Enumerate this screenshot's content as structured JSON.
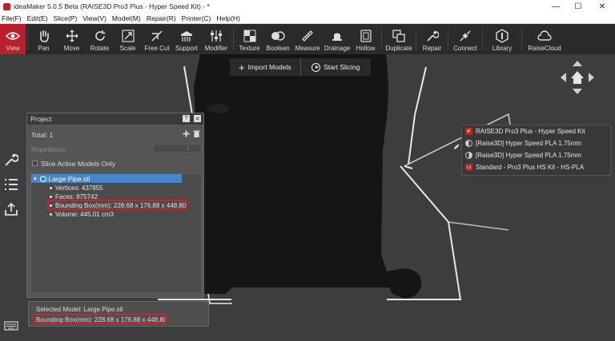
{
  "window": {
    "title": "ideaMaker 5.0.5 Beta (RAISE3D Pro3 Plus - Hyper Speed Kit) - *",
    "minimize": "—",
    "maximize": "☐",
    "close": "✕"
  },
  "menu": [
    "File(F)",
    "Edit(E)",
    "Slice(P)",
    "View(V)",
    "Model(M)",
    "Repair(R)",
    "Printer(C)",
    "Help(H)"
  ],
  "toolbar": {
    "tools": [
      {
        "label": "View",
        "icon": "eye-icon",
        "active": true
      },
      {
        "label": "Pan",
        "icon": "hand-icon"
      },
      {
        "label": "Move",
        "icon": "move-icon"
      },
      {
        "label": "Rotate",
        "icon": "rotate-icon"
      },
      {
        "label": "Scale",
        "icon": "scale-icon"
      },
      {
        "label": "Free Cut",
        "icon": "cut-icon"
      },
      {
        "label": "Support",
        "icon": "support-icon"
      },
      {
        "label": "Modifier",
        "icon": "modifier-icon"
      },
      {
        "label": "Texture",
        "icon": "texture-icon"
      },
      {
        "label": "Boolean",
        "icon": "boolean-icon"
      },
      {
        "label": "Measure",
        "icon": "ruler-icon"
      },
      {
        "label": "Drainage",
        "icon": "drainage-icon"
      },
      {
        "label": "Hollow",
        "icon": "hollow-icon"
      },
      {
        "label": "Duplicate",
        "icon": "duplicate-icon"
      },
      {
        "label": "Repair",
        "icon": "wrench-icon"
      },
      {
        "label": "Connect",
        "icon": "connect-icon"
      },
      {
        "label": "Library",
        "icon": "library-icon"
      },
      {
        "label": "RaiseCloud",
        "icon": "cloud-icon"
      }
    ]
  },
  "viewport": {
    "import_label": "Import Models",
    "slice_label": "Start Slicing"
  },
  "project": {
    "title": "Project",
    "total": "Total: 1",
    "repetitions_label": "Repetitions:",
    "repetitions_value": "1",
    "slice_active_label": "Slice Active Models Only",
    "model": {
      "name": "Large Pipe.stl",
      "vertices": "Vertices: 437855",
      "faces": "Faces: 875742",
      "bounding_box": "Bounding Box(mm): 228.68 x 176.88 x 448.80",
      "volume": "Volume: 445.01 cm3"
    }
  },
  "info": {
    "selected": "Selected Model: Large Pipe.stl",
    "bounding_box": "Bounding Box(mm): 228.68 x 176.88 x 448.80"
  },
  "printer": {
    "printer_name": "RAISE3D Pro3 Plus - Hyper Speed Kit",
    "filament_left": "[Raise3D] Hyper Speed PLA 1.75mm",
    "filament_right": "[Raise3D] Hyper Speed PLA 1.75mm",
    "template_badge": "L2",
    "template": "Standard - Pro3 Plus HS Kit - HS-PLA"
  },
  "colors": {
    "accent": "#b8202d",
    "highlight": "#d3202a",
    "selection": "#4686c8"
  }
}
